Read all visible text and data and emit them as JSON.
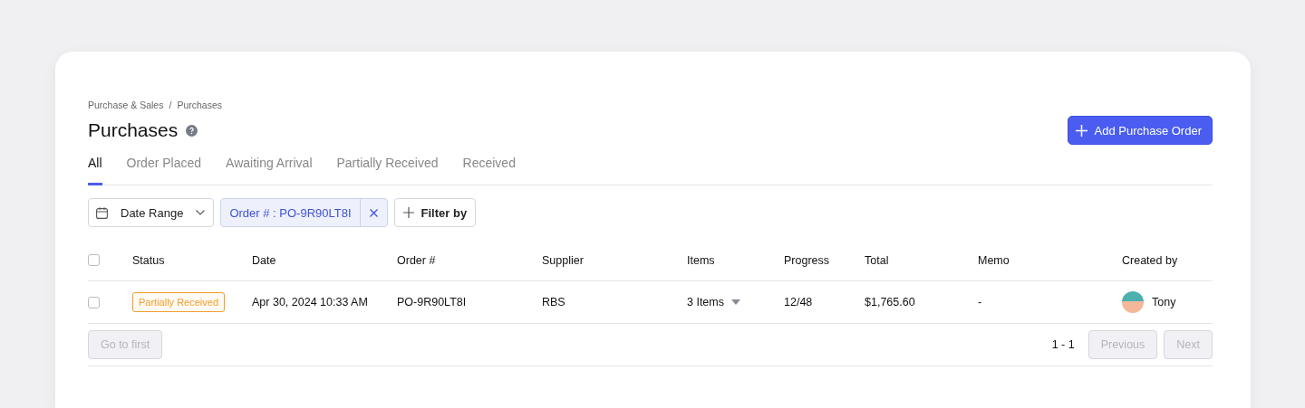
{
  "breadcrumb": [
    "Purchase & Sales",
    "Purchases"
  ],
  "breadcrumb_separator": "/",
  "title": "Purchases",
  "primary_button": {
    "label": "Add Purchase Order"
  },
  "tabs": [
    {
      "label": "All",
      "selected": true
    },
    {
      "label": "Order Placed",
      "selected": false
    },
    {
      "label": "Awaiting Arrival",
      "selected": false
    },
    {
      "label": "Partially Received",
      "selected": false
    },
    {
      "label": "Received",
      "selected": false
    }
  ],
  "filters": {
    "date_range": {
      "label": "Date Range"
    },
    "active_filter": {
      "label": "Order # : PO-9R90LT8I"
    },
    "add_filter": {
      "label": "Filter by"
    }
  },
  "table": {
    "select_all_checked": false,
    "columns": [
      "Status",
      "Date",
      "Order #",
      "Supplier",
      "Items",
      "Progress",
      "Total",
      "Memo",
      "Created by"
    ],
    "rows": [
      {
        "checked": false,
        "status": {
          "label": "Partially Received",
          "color": "#f29d2a"
        },
        "date": "Apr 30, 2024 10:33 AM",
        "order": "PO-9R90LT8I",
        "supplier": "RBS",
        "items": "3 Items",
        "progress": "12/48",
        "total": "$1,765.60",
        "memo": "-",
        "created_by": "Tony"
      }
    ]
  },
  "pagination": {
    "first": {
      "label": "Go to first",
      "disabled": true
    },
    "range": "1 - 1",
    "previous": {
      "label": "Previous",
      "disabled": true
    },
    "next": {
      "label": "Next",
      "disabled": true
    }
  }
}
